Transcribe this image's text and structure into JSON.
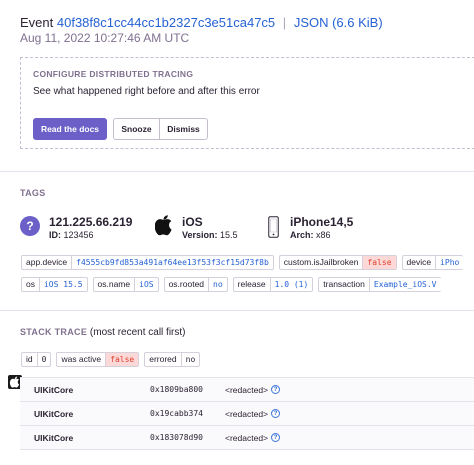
{
  "event": {
    "label": "Event",
    "id": "40f38f8c1cc44cc1b2327c3e51ca47c5",
    "separator": "|",
    "json_link": "JSON (6.6 KiB)",
    "timestamp": "Aug 11, 2022 10:27:46 AM UTC"
  },
  "tracing": {
    "title": "CONFIGURE DISTRIBUTED TRACING",
    "text": "See what happened right before and after this error",
    "read_docs": "Read the docs",
    "snooze": "Snooze",
    "dismiss": "Dismiss"
  },
  "tags_section": {
    "title": "TAGS",
    "user": {
      "ip": "121.225.66.219",
      "id_label": "ID:",
      "id_value": "123456",
      "icon": "user-icon",
      "color": "#6c5fc7"
    },
    "os": {
      "name": "iOS",
      "version_label": "Version:",
      "version_value": "15.5",
      "icon": "apple-icon"
    },
    "device": {
      "name": "iPhone14,5",
      "arch_label": "Arch:",
      "arch_value": "x86",
      "icon": "phone-icon"
    },
    "tags": [
      {
        "key": "app.device",
        "value": "f4555cb9fd853a491af64ee13f53f3cf15d73f8b"
      },
      {
        "key": "custom.isJailbroken",
        "value": "false"
      },
      {
        "key": "device",
        "value": "iPho"
      },
      {
        "key": "os",
        "value": "iOS 15.5"
      },
      {
        "key": "os.name",
        "value": "iOS"
      },
      {
        "key": "os.rooted",
        "value": "no"
      },
      {
        "key": "release",
        "value": "1.0 (1)"
      },
      {
        "key": "transaction",
        "value": "Example_iOS.V"
      }
    ]
  },
  "stack": {
    "title": "STACK TRACE",
    "subtitle": "(most recent call first)",
    "meta": [
      {
        "key": "id",
        "value": "0"
      },
      {
        "key": "was active",
        "value": "false"
      },
      {
        "key": "errored",
        "value": "no"
      }
    ],
    "frames": [
      {
        "package": "UIKitCore",
        "address": "0x1809ba800",
        "function": "<redacted>"
      },
      {
        "package": "UIKitCore",
        "address": "0x19cabb374",
        "function": "<redacted>"
      },
      {
        "package": "UIKitCore",
        "address": "0x183078d90",
        "function": "<redacted>"
      }
    ]
  }
}
